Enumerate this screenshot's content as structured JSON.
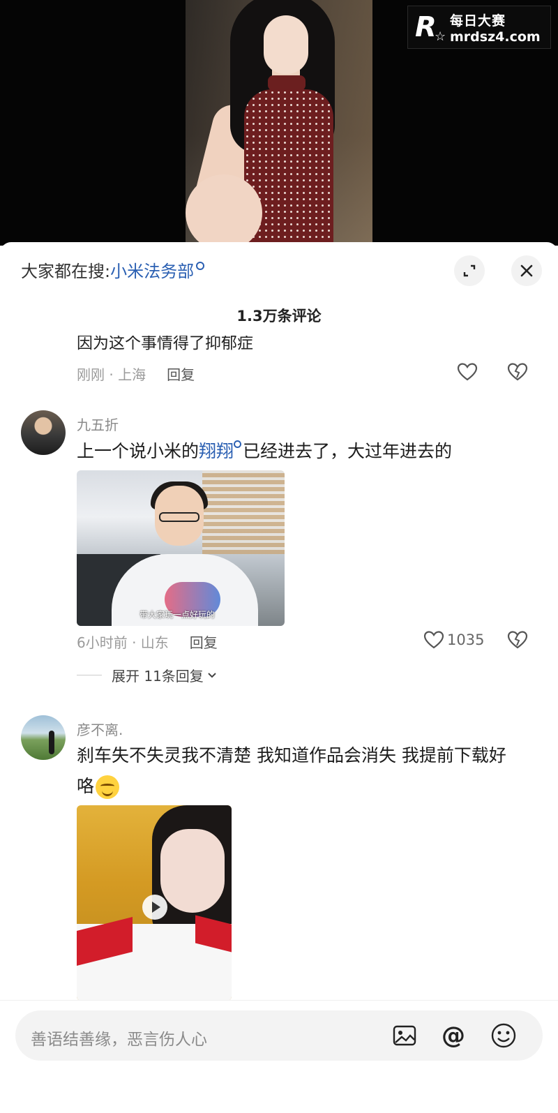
{
  "watermark": {
    "logo": "R",
    "cn": "每日大赛",
    "url": "mrdsz4.com"
  },
  "sheet": {
    "search": {
      "prefix": "大家都在搜:",
      "term": "小米法务部"
    },
    "comment_count": "1.3万条评论"
  },
  "comments": [
    {
      "partial_text": "因为这个事情得了抑郁症",
      "time_location": "刚刚 · 上海",
      "reply_label": "回复"
    },
    {
      "username": "九五折",
      "text_before": "上一个说小米的",
      "text_link": "翔翔",
      "text_after": "已经进去了，大过年进去的",
      "image_caption": "带大家玩一点好玩的",
      "time_location": "6小时前 · 山东",
      "reply_label": "回复",
      "like_count": "1035",
      "expand_label": "展开 11条回复"
    },
    {
      "username": "彦不离.",
      "text_line1": "刹车失不失灵我不清楚 我知道作品会消失 我提前下载好",
      "text_line2": "咯"
    }
  ],
  "bottom_bar": {
    "placeholder": "善语结善缘，恶言伤人心"
  },
  "icons": {
    "expand": "expand-icon",
    "close": "close-icon",
    "heart": "heart-icon",
    "broken_heart": "broken-heart-icon",
    "image": "image-icon",
    "mention": "at-icon",
    "emoji": "emoji-icon",
    "play": "play-icon"
  },
  "colors": {
    "link": "#2a5fb2",
    "text": "#1c1c1c",
    "muted": "#9a9a9a"
  }
}
